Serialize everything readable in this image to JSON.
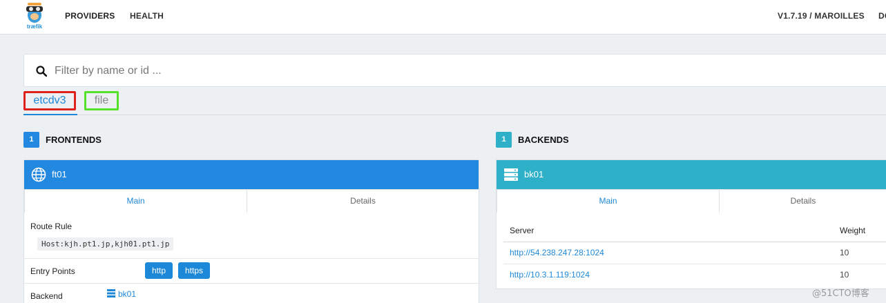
{
  "nav": {
    "logo_text": "træfik",
    "items": [
      {
        "label": "PROVIDERS"
      },
      {
        "label": "HEALTH"
      }
    ],
    "version": "V1.7.19 / MAROILLES",
    "doc": "DO"
  },
  "search": {
    "placeholder": "Filter by name or id ...",
    "value": ""
  },
  "providers": {
    "tabs": [
      {
        "label": "etcdv3",
        "active": true
      },
      {
        "label": "file",
        "active": false
      }
    ]
  },
  "frontends": {
    "count": "1",
    "title": "FRONTENDS",
    "color": "#2288e0",
    "item": {
      "name": "ft01",
      "icon": "globe-icon",
      "tabs": [
        "Main",
        "Details"
      ],
      "route_rule_label": "Route Rule",
      "route_rule": "Host:kjh.pt1.jp,kjh01.pt1.jp",
      "entry_points_label": "Entry Points",
      "entry_points": [
        "http",
        "https"
      ],
      "backend_label": "Backend",
      "backend": "bk01"
    }
  },
  "backends": {
    "count": "1",
    "title": "BACKENDS",
    "color": "#2eb0c8",
    "item": {
      "name": "bk01",
      "icon": "server-stack-icon",
      "tabs": [
        "Main",
        "Details"
      ],
      "columns": [
        "Server",
        "Weight"
      ],
      "servers": [
        {
          "url": "http://54.238.247.28:1024",
          "weight": "10"
        },
        {
          "url": "http://10.3.1.119:1024",
          "weight": "10"
        }
      ]
    }
  },
  "watermark": "@51CTO博客"
}
